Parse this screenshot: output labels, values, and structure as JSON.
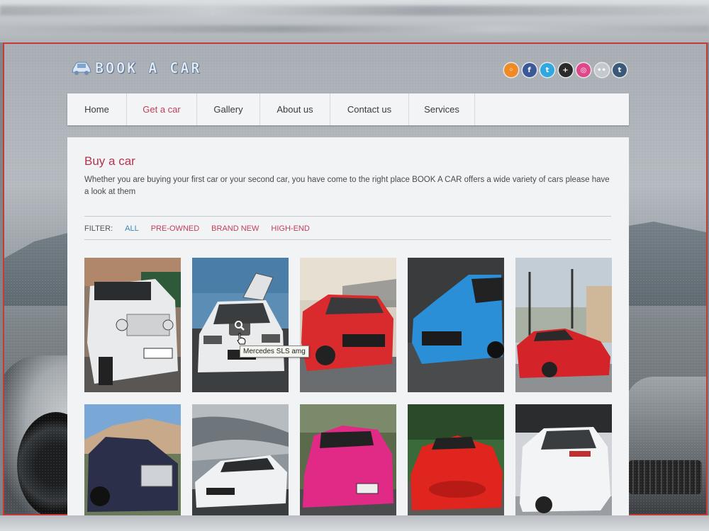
{
  "brand": {
    "logo_text": "BOOK A CAR"
  },
  "social": [
    {
      "name": "rss-icon",
      "glyph": "◦",
      "color": "#f08a24"
    },
    {
      "name": "facebook-icon",
      "glyph": "f",
      "color": "#3b5998"
    },
    {
      "name": "twitter-icon",
      "glyph": "t",
      "color": "#2fa8e0"
    },
    {
      "name": "plus-icon",
      "glyph": "+",
      "color": "#2b2b2b"
    },
    {
      "name": "dribbble-icon",
      "glyph": "◎",
      "color": "#e0468a"
    },
    {
      "name": "flickr-icon",
      "glyph": "••",
      "color": "#c5c9cd"
    },
    {
      "name": "tumblr-icon",
      "glyph": "t",
      "color": "#3b5a7a"
    }
  ],
  "nav": {
    "items": [
      {
        "label": "Home",
        "width": 84
      },
      {
        "label": "Get a car",
        "width": 99
      },
      {
        "label": "Gallery",
        "width": 89
      },
      {
        "label": "About us",
        "width": 99
      },
      {
        "label": "Contact us",
        "width": 111
      },
      {
        "label": "Services",
        "width": 93
      }
    ],
    "active_index": 1
  },
  "content": {
    "title": "Buy a car",
    "description": "Whether you are buying your first car or your second car, you have come to the right place BOOK A CAR offers a wide variety of cars please have a look at them"
  },
  "filter": {
    "label": "FILTER:",
    "options": [
      "ALL",
      "PRE-OWNED",
      "BRAND NEW",
      "HIGH-END"
    ],
    "selected": "ALL"
  },
  "gallery": {
    "tooltip": "Mercedes SLS amg",
    "items": [
      {
        "id": "suv-white",
        "alt": "White G-class SUV"
      },
      {
        "id": "mercedes-sls",
        "alt": "Mercedes SLS amg"
      },
      {
        "id": "mustang-red",
        "alt": "Red Mustang"
      },
      {
        "id": "mustang-blue",
        "alt": "Blue Mustang"
      },
      {
        "id": "ferrari-red",
        "alt": "Red Ferrari"
      },
      {
        "id": "rolls-royce",
        "alt": "Rolls Royce"
      },
      {
        "id": "lambo-white",
        "alt": "White Lamborghini"
      },
      {
        "id": "lambo-pink",
        "alt": "Pink Lamborghini"
      },
      {
        "id": "supercar-red",
        "alt": "Red supercar"
      },
      {
        "id": "golf-white",
        "alt": "White hatchback"
      }
    ]
  },
  "colors": {
    "accent": "#c0405a",
    "link_blue": "#3a86b8"
  }
}
